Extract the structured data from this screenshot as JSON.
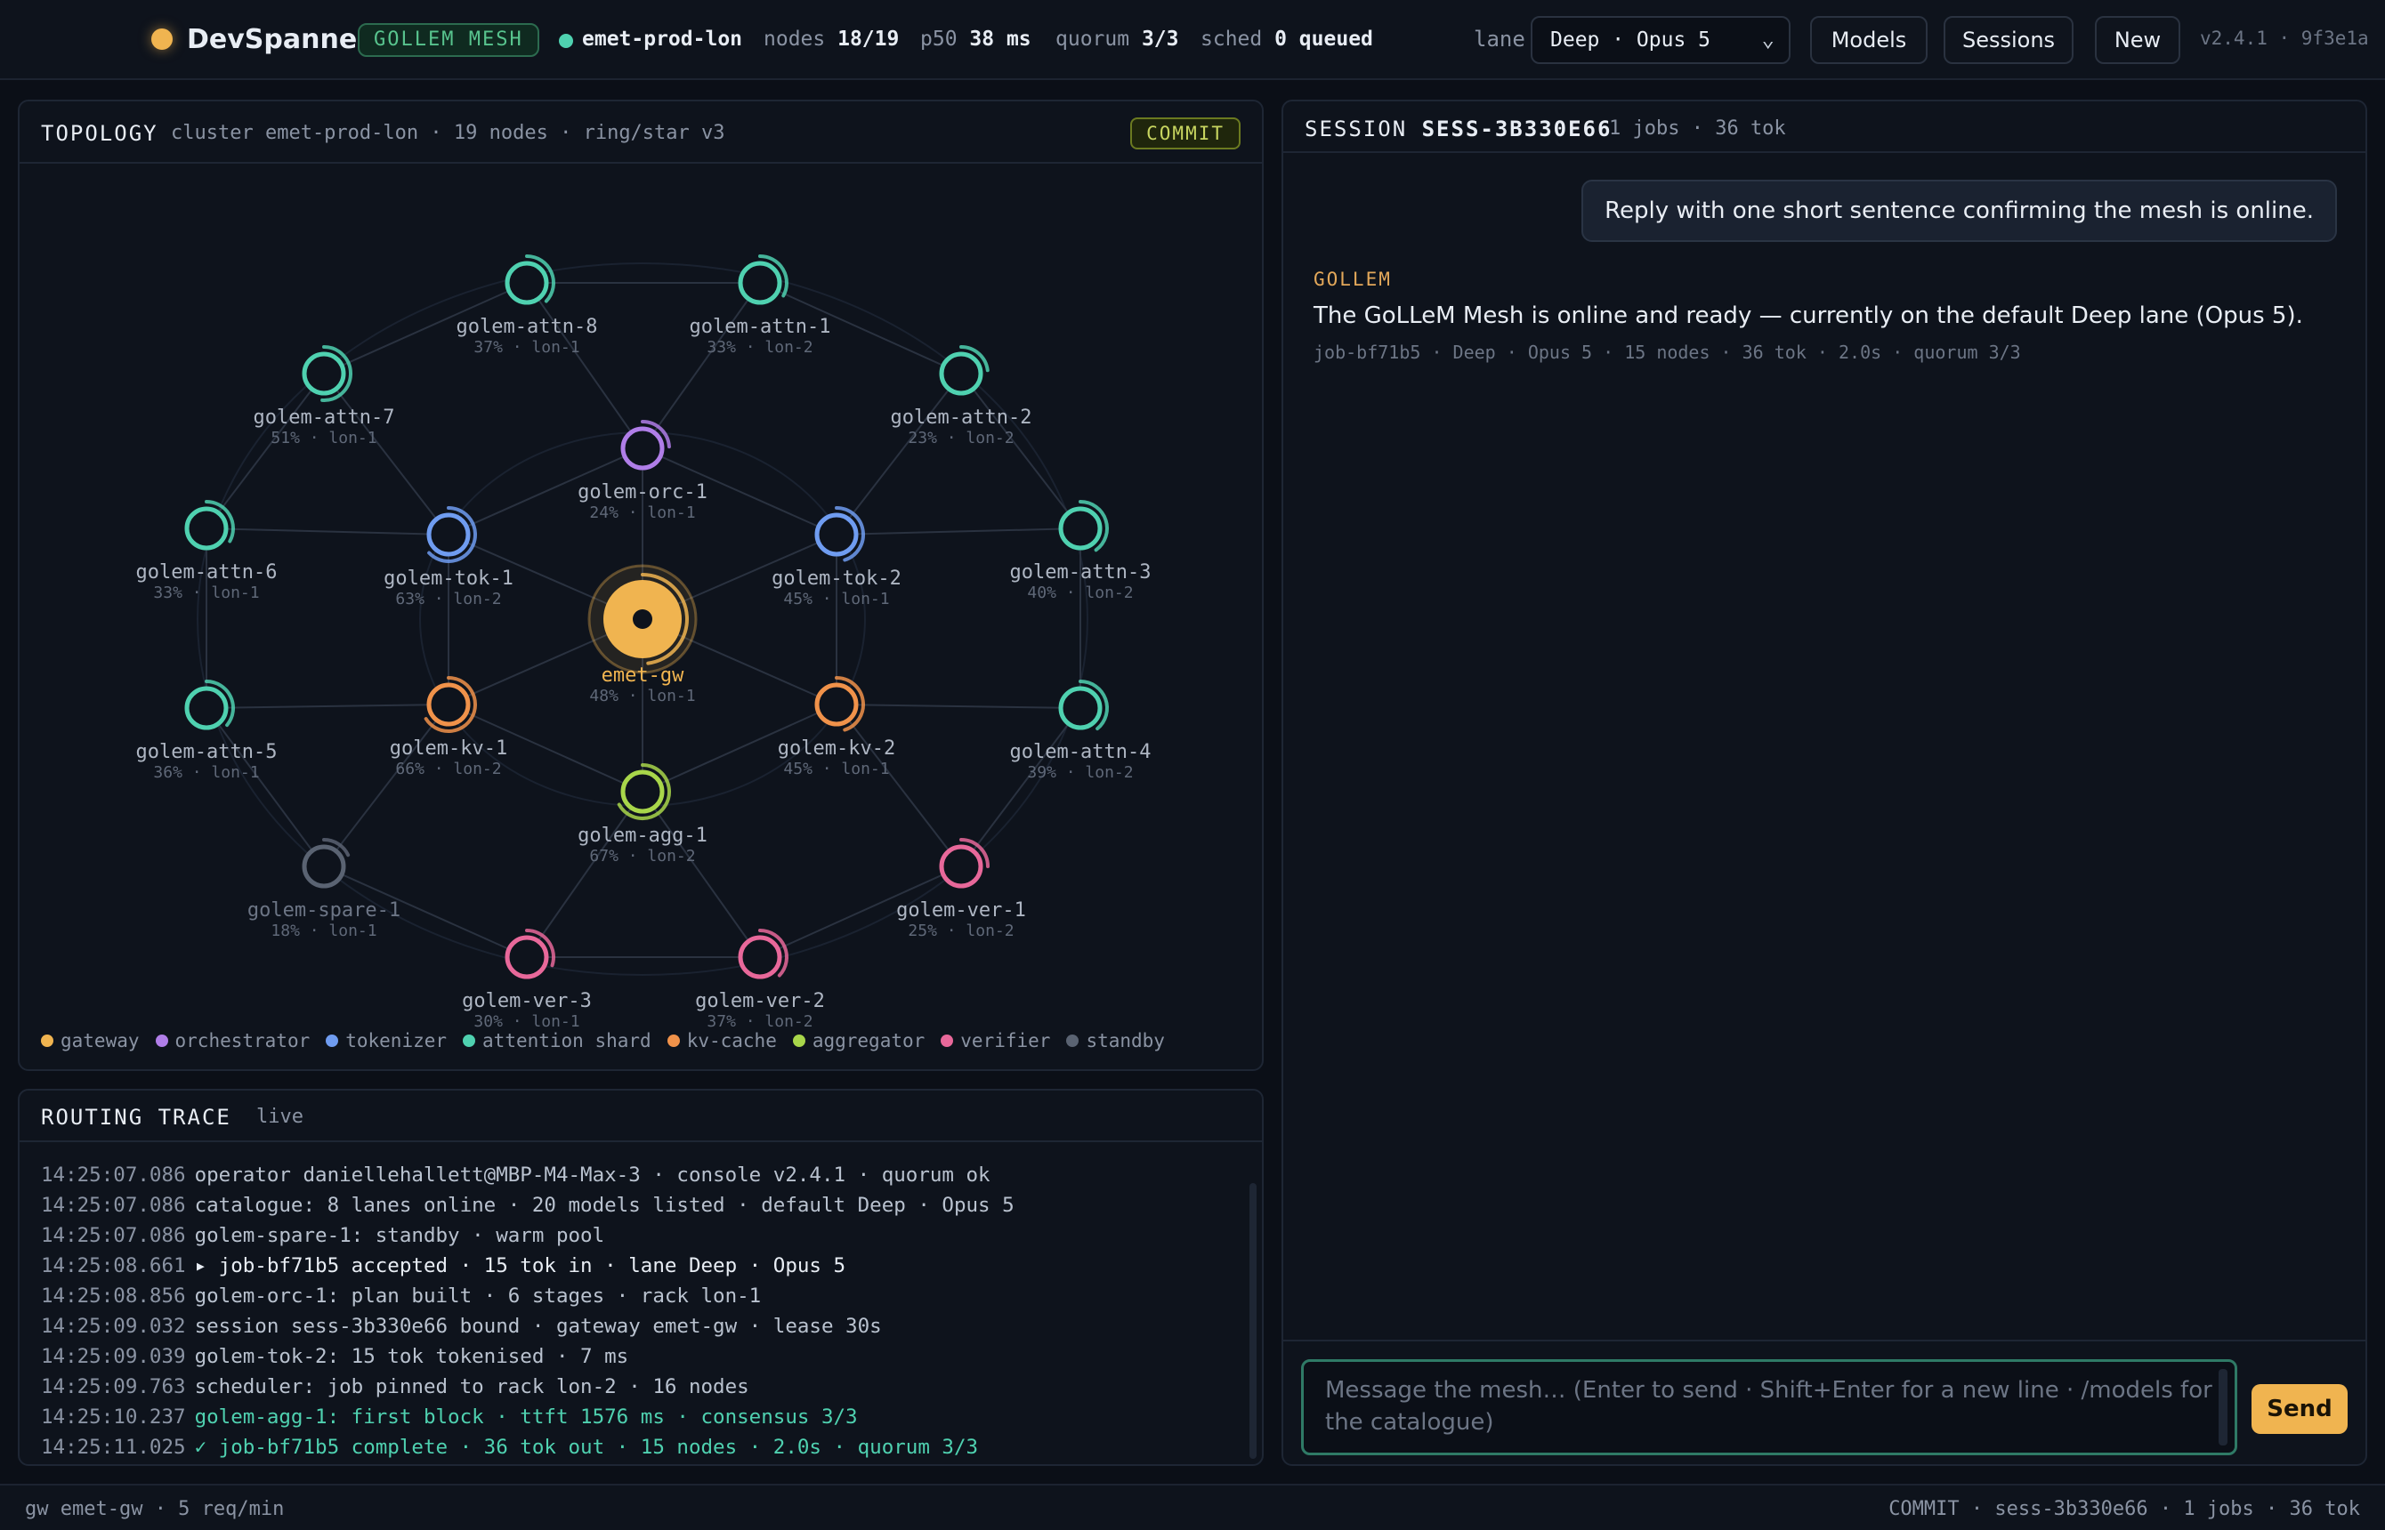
{
  "app": {
    "name": "DevSpanner",
    "badge": "GOLLEM MESH",
    "cluster": "emet-prod-lon",
    "version": "v2.4.1 · 9f3e1a"
  },
  "stats": {
    "nodes_label": "nodes",
    "nodes_value": "18/19",
    "p50_label": "p50",
    "p50_value": "38 ms",
    "quorum_label": "quorum",
    "quorum_value": "3/3",
    "sched_label": "sched",
    "sched_value": "0 queued"
  },
  "lane": {
    "label": "lane",
    "selected": "Deep · Opus 5"
  },
  "buttons": {
    "models": "Models",
    "sessions": "Sessions",
    "new": "New",
    "send": "Send"
  },
  "topology": {
    "title": "TOPOLOGY",
    "subtitle": "cluster emet-prod-lon · 19 nodes · ring/star v3",
    "badge": "COMMIT",
    "legend": [
      {
        "label": "gateway",
        "color": "#f0b450"
      },
      {
        "label": "orchestrator",
        "color": "#b07ee8"
      },
      {
        "label": "tokenizer",
        "color": "#6f9cf0"
      },
      {
        "label": "attention shard",
        "color": "#4fd1b0"
      },
      {
        "label": "kv-cache",
        "color": "#f0924a"
      },
      {
        "label": "aggregator",
        "color": "#a8d64a"
      },
      {
        "label": "verifier",
        "color": "#e8689a"
      },
      {
        "label": "standby",
        "color": "#5a6372"
      }
    ],
    "nodes": [
      {
        "id": "gw",
        "name": "emet-gw",
        "load": 48,
        "rack": "lon-1",
        "role": "gateway"
      },
      {
        "id": "orc1",
        "name": "golem-orc-1",
        "load": 24,
        "rack": "lon-1",
        "role": "orchestrator"
      },
      {
        "id": "tok1",
        "name": "golem-tok-1",
        "load": 63,
        "rack": "lon-2",
        "role": "tokenizer"
      },
      {
        "id": "tok2",
        "name": "golem-tok-2",
        "load": 45,
        "rack": "lon-1",
        "role": "tokenizer"
      },
      {
        "id": "kv1",
        "name": "golem-kv-1",
        "load": 66,
        "rack": "lon-2",
        "role": "kv-cache"
      },
      {
        "id": "kv2",
        "name": "golem-kv-2",
        "load": 45,
        "rack": "lon-1",
        "role": "kv-cache"
      },
      {
        "id": "agg1",
        "name": "golem-agg-1",
        "load": 67,
        "rack": "lon-2",
        "role": "aggregator"
      },
      {
        "id": "attn8",
        "name": "golem-attn-8",
        "load": 37,
        "rack": "lon-1",
        "role": "attention shard"
      },
      {
        "id": "attn1",
        "name": "golem-attn-1",
        "load": 33,
        "rack": "lon-2",
        "role": "attention shard"
      },
      {
        "id": "attn7",
        "name": "golem-attn-7",
        "load": 51,
        "rack": "lon-1",
        "role": "attention shard"
      },
      {
        "id": "attn2",
        "name": "golem-attn-2",
        "load": 23,
        "rack": "lon-2",
        "role": "attention shard"
      },
      {
        "id": "attn6",
        "name": "golem-attn-6",
        "load": 33,
        "rack": "lon-1",
        "role": "attention shard"
      },
      {
        "id": "attn3",
        "name": "golem-attn-3",
        "load": 40,
        "rack": "lon-2",
        "role": "attention shard"
      },
      {
        "id": "attn5",
        "name": "golem-attn-5",
        "load": 36,
        "rack": "lon-1",
        "role": "attention shard"
      },
      {
        "id": "attn4",
        "name": "golem-attn-4",
        "load": 39,
        "rack": "lon-2",
        "role": "attention shard"
      },
      {
        "id": "spare1",
        "name": "golem-spare-1",
        "load": 18,
        "rack": "lon-1",
        "role": "standby"
      },
      {
        "id": "ver1",
        "name": "golem-ver-1",
        "load": 25,
        "rack": "lon-2",
        "role": "verifier"
      },
      {
        "id": "ver3",
        "name": "golem-ver-3",
        "load": 30,
        "rack": "lon-1",
        "role": "verifier"
      },
      {
        "id": "ver2",
        "name": "golem-ver-2",
        "load": 37,
        "rack": "lon-2",
        "role": "verifier"
      }
    ],
    "links": [
      [
        "gw",
        "orc1"
      ],
      [
        "gw",
        "tok1"
      ],
      [
        "gw",
        "tok2"
      ],
      [
        "gw",
        "kv1"
      ],
      [
        "gw",
        "kv2"
      ],
      [
        "gw",
        "agg1"
      ],
      [
        "orc1",
        "tok1"
      ],
      [
        "orc1",
        "tok2"
      ],
      [
        "orc1",
        "attn8"
      ],
      [
        "orc1",
        "attn1"
      ],
      [
        "tok1",
        "attn7"
      ],
      [
        "tok1",
        "attn6"
      ],
      [
        "tok1",
        "kv1"
      ],
      [
        "tok2",
        "attn2"
      ],
      [
        "tok2",
        "attn3"
      ],
      [
        "tok2",
        "kv2"
      ],
      [
        "kv1",
        "attn5"
      ],
      [
        "kv1",
        "agg1"
      ],
      [
        "kv1",
        "spare1"
      ],
      [
        "kv2",
        "attn4"
      ],
      [
        "kv2",
        "agg1"
      ],
      [
        "kv2",
        "ver1"
      ],
      [
        "agg1",
        "ver3"
      ],
      [
        "agg1",
        "ver2"
      ],
      [
        "attn8",
        "attn1"
      ],
      [
        "attn1",
        "attn2"
      ],
      [
        "attn2",
        "attn3"
      ],
      [
        "attn3",
        "attn4"
      ],
      [
        "attn4",
        "ver1"
      ],
      [
        "ver1",
        "ver2"
      ],
      [
        "ver2",
        "ver3"
      ],
      [
        "ver3",
        "spare1"
      ],
      [
        "spare1",
        "attn5"
      ],
      [
        "attn5",
        "attn6"
      ],
      [
        "attn6",
        "attn7"
      ],
      [
        "attn7",
        "attn8"
      ]
    ]
  },
  "trace": {
    "title": "ROUTING TRACE",
    "status": "live",
    "lines": [
      {
        "ts": "14:25:07.086",
        "text": "operator daniellehallett@MBP-M4-Max-3 · console v2.4.1 · quorum ok",
        "kind": ""
      },
      {
        "ts": "14:25:07.086",
        "text": "catalogue: 8 lanes online · 20 models listed · default Deep · Opus 5",
        "kind": ""
      },
      {
        "ts": "14:25:07.086",
        "text": "golem-spare-1: standby · warm pool",
        "kind": ""
      },
      {
        "ts": "14:25:08.661",
        "text": "▸ job-bf71b5 accepted · 15 tok in · lane Deep · Opus 5",
        "kind": "hi"
      },
      {
        "ts": "14:25:08.856",
        "text": "golem-orc-1: plan built · 6 stages · rack lon-1",
        "kind": ""
      },
      {
        "ts": "14:25:09.032",
        "text": "session sess-3b330e66 bound · gateway emet-gw · lease 30s",
        "kind": ""
      },
      {
        "ts": "14:25:09.039",
        "text": "golem-tok-2: 15 tok tokenised · 7 ms",
        "kind": ""
      },
      {
        "ts": "14:25:09.763",
        "text": "scheduler: job pinned to rack lon-2 · 16 nodes",
        "kind": ""
      },
      {
        "ts": "14:25:10.237",
        "text": "golem-agg-1: first block · ttft 1576 ms · consensus 3/3",
        "kind": "ok"
      },
      {
        "ts": "14:25:11.025",
        "text": "✓ job-bf71b5 complete · 36 tok out · 15 nodes · 2.0s · quorum 3/3",
        "kind": "ok"
      }
    ]
  },
  "session": {
    "label": "SESSION",
    "id": "SESS-3B330E66",
    "meta": "1 jobs · 36 tok",
    "user_message": "Reply with one short sentence confirming the mesh is online.",
    "reply_from": "GOLLEM",
    "reply_text": "The GoLLeM Mesh is online and ready — currently on the default Deep lane (Opus 5).",
    "reply_meta": "job-bf71b5 · Deep · Opus 5 · 15 nodes · 36 tok · 2.0s · quorum 3/3",
    "composer_placeholder": "Message the mesh…  (Enter to send · Shift+Enter for a new line · /models for the catalogue)"
  },
  "status": {
    "left": "gw emet-gw · 5 req/min",
    "right": "COMMIT · sess-3b330e66 · 1 jobs · 36 tok"
  }
}
